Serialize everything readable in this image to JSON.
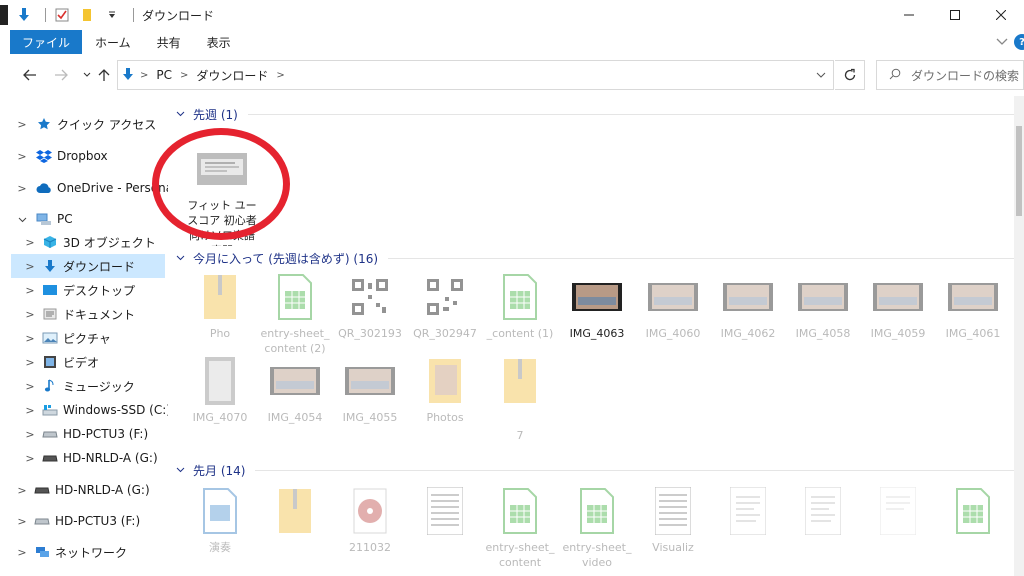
{
  "window": {
    "title": "ダウンロード",
    "controls": [
      "minimize",
      "maximize",
      "close"
    ]
  },
  "ribbon": {
    "tabs": [
      {
        "label": "ファイル",
        "active": true
      },
      {
        "label": "ホーム"
      },
      {
        "label": "共有"
      },
      {
        "label": "表示"
      }
    ],
    "help": "?"
  },
  "address": {
    "crumbs": [
      "PC",
      "ダウンロード"
    ]
  },
  "search": {
    "placeholder": "ダウンロードの検索"
  },
  "nav": {
    "items": [
      {
        "label": "クイック アクセス",
        "icon": "star-icon"
      },
      {
        "label": "Dropbox",
        "icon": "dropbox-icon"
      },
      {
        "label": "OneDrive - Persona",
        "icon": "cloud-icon"
      },
      {
        "label": "PC",
        "icon": "pc-icon"
      },
      {
        "label": "3D オブジェクト",
        "icon": "cube-icon"
      },
      {
        "label": "ダウンロード",
        "icon": "download-icon",
        "selected": true
      },
      {
        "label": "デスクトップ",
        "icon": "desktop-icon"
      },
      {
        "label": "ドキュメント",
        "icon": "document-icon"
      },
      {
        "label": "ピクチャ",
        "icon": "picture-icon"
      },
      {
        "label": "ビデオ",
        "icon": "video-icon"
      },
      {
        "label": "ミュージック",
        "icon": "music-icon"
      },
      {
        "label": "Windows-SSD (C:)",
        "icon": "drive-icon"
      },
      {
        "label": "HD-PCTU3 (F:)",
        "icon": "drive-icon"
      },
      {
        "label": "HD-NRLD-A (G:)",
        "icon": "drive-icon"
      },
      {
        "label": "HD-NRLD-A (G:)",
        "icon": "drive-icon"
      },
      {
        "label": "HD-PCTU3 (F:)",
        "icon": "drive-icon"
      },
      {
        "label": "ネットワーク",
        "icon": "network-icon"
      }
    ]
  },
  "groups": [
    {
      "header": "先週 (1)",
      "items": [
        {
          "label": "フィット ユースコア 初心者向けソロ楽譜専門",
          "icon": "image-thumb",
          "dim": false
        }
      ]
    },
    {
      "header": "今月に入って (先週は含めず) (16)",
      "items": [
        {
          "label": "Pho",
          "icon": "zip-folder"
        },
        {
          "label": "entry-sheet_content (2)",
          "icon": "spreadsheet"
        },
        {
          "label": "QR_302193",
          "icon": "qr-code"
        },
        {
          "label": "QR_302947",
          "icon": "qr-code"
        },
        {
          "label": "_content (1)",
          "icon": "spreadsheet"
        },
        {
          "label": "IMG_4063",
          "icon": "video-thumb"
        },
        {
          "label": "IMG_4060",
          "icon": "video-thumb"
        },
        {
          "label": "IMG_4062",
          "icon": "video-thumb"
        },
        {
          "label": "IMG_4058",
          "icon": "video-thumb"
        },
        {
          "label": "IMG_4059",
          "icon": "video-thumb"
        },
        {
          "label": "IMG_4061",
          "icon": "video-thumb"
        },
        {
          "label": "IMG_4070",
          "icon": "gray-thumb"
        },
        {
          "label": "IMG_4054",
          "icon": "video-thumb"
        },
        {
          "label": "IMG_4055",
          "icon": "video-thumb"
        },
        {
          "label": "Photos",
          "icon": "folder"
        },
        {
          "label": "7",
          "icon": "zip-folder"
        }
      ]
    },
    {
      "header": "先月 (14)",
      "items": [
        {
          "label": "演奏",
          "icon": "doc-image"
        },
        {
          "label": "",
          "icon": "zip-folder"
        },
        {
          "label": "211032",
          "icon": "disc"
        },
        {
          "label": "",
          "icon": "sheet-music"
        },
        {
          "label": "entry-sheet_content",
          "icon": "spreadsheet"
        },
        {
          "label": "entry-sheet_video",
          "icon": "spreadsheet"
        },
        {
          "label": "Visualiz",
          "icon": "sheet-music"
        },
        {
          "label": "",
          "icon": "doc-page"
        },
        {
          "label": "",
          "icon": "doc-page"
        },
        {
          "label": "",
          "icon": "doc-page"
        },
        {
          "label": "",
          "icon": "spreadsheet"
        }
      ]
    }
  ],
  "colors": {
    "accent": "#1979ca",
    "selected": "#cce8ff",
    "annotation": "#e5232f",
    "group_header": "#1e3287"
  }
}
